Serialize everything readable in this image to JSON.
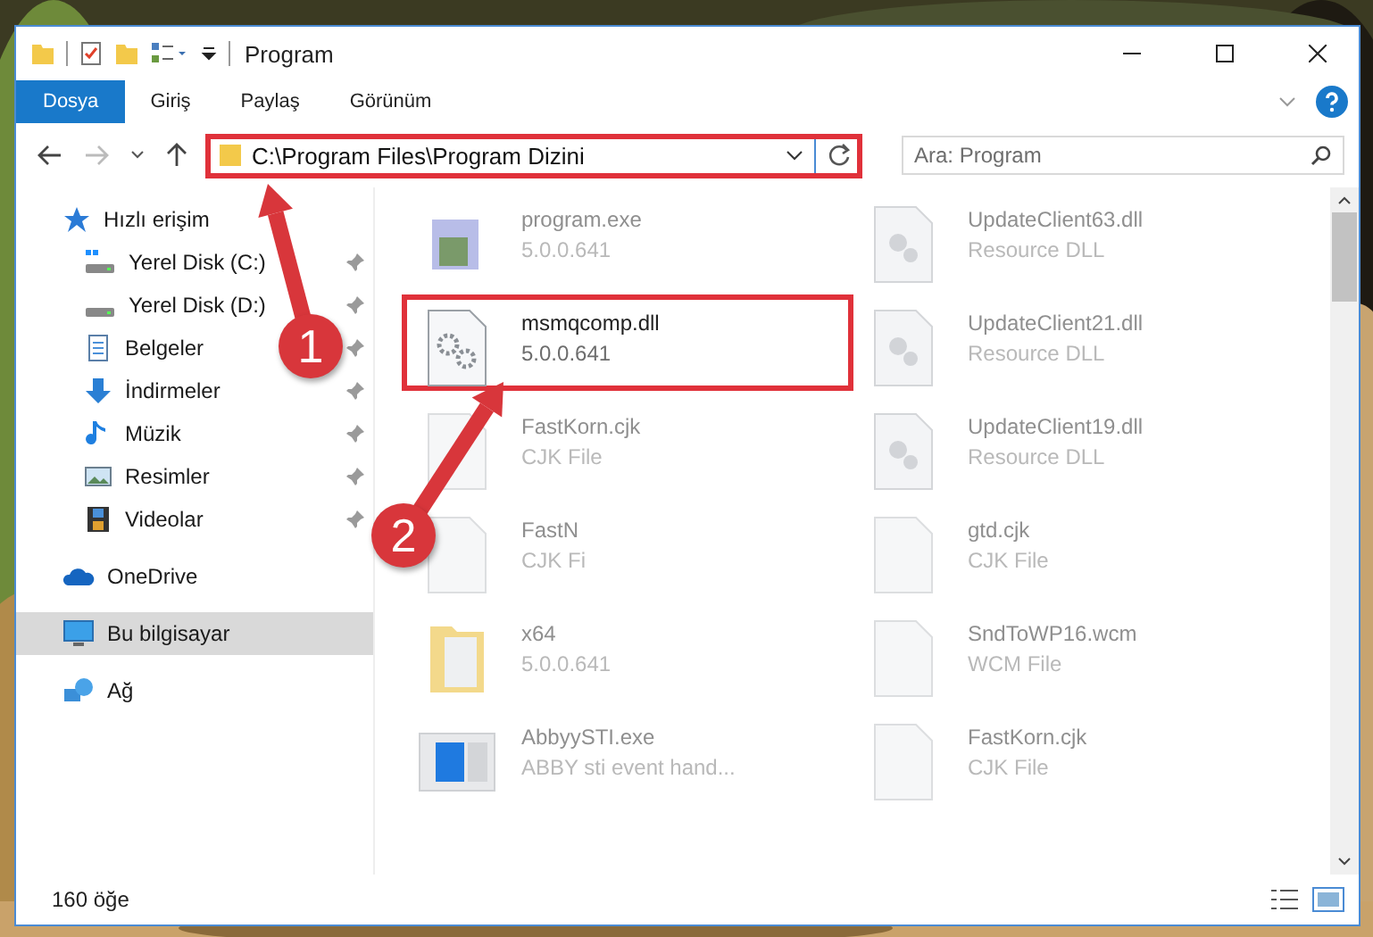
{
  "window": {
    "title": "Program"
  },
  "ribbon_tabs": [
    {
      "label": "Dosya",
      "kind": "file"
    },
    {
      "label": "Giriş",
      "kind": "tab"
    },
    {
      "label": "Paylaş",
      "kind": "tab"
    },
    {
      "label": "Görünüm",
      "kind": "tab"
    }
  ],
  "address_bar": {
    "path": "C:\\Program Files\\Program Dizini",
    "highlighted": true
  },
  "search": {
    "placeholder": "Ara: Program"
  },
  "navigation": [
    {
      "label": "Hızlı erişim",
      "selected": false,
      "children": [
        {
          "label": "Yerel Disk (C:)",
          "pinned": true,
          "selected": false
        },
        {
          "label": "Yerel Disk (D:)",
          "pinned": true,
          "selected": false
        },
        {
          "label": "Belgeler",
          "pinned": true,
          "selected": false
        },
        {
          "label": "İndirmeler",
          "pinned": true,
          "selected": false
        },
        {
          "label": "Müzik",
          "pinned": true,
          "selected": false
        },
        {
          "label": "Resimler",
          "pinned": true,
          "selected": false
        },
        {
          "label": "Videolar",
          "pinned": true,
          "selected": false
        }
      ]
    },
    {
      "label": "OneDrive",
      "selected": false
    },
    {
      "label": "Bu bilgisayar",
      "selected": true
    },
    {
      "label": "Ağ",
      "selected": false
    }
  ],
  "files": [
    {
      "name": "program.exe",
      "detail": "5.0.0.641",
      "highlighted": false
    },
    {
      "name": "UpdateClient63.dll",
      "detail": "Resource DLL",
      "highlighted": false
    },
    {
      "name": "msmqcomp.dll",
      "detail": "5.0.0.641",
      "highlighted": true
    },
    {
      "name": "UpdateClient21.dll",
      "detail": "Resource DLL",
      "highlighted": false
    },
    {
      "name": "FastKorn.cjk",
      "detail": "CJK File",
      "highlighted": false
    },
    {
      "name": "UpdateClient19.dll",
      "detail": "Resource DLL",
      "highlighted": false
    },
    {
      "name": "FastN",
      "detail": "CJK Fi",
      "highlighted": false
    },
    {
      "name": "gtd.cjk",
      "detail": "CJK File",
      "highlighted": false
    },
    {
      "name": "x64",
      "detail": "5.0.0.641",
      "highlighted": false
    },
    {
      "name": "SndToWP16.wcm",
      "detail": "WCM File",
      "highlighted": false
    },
    {
      "name": "AbbyySTI.exe",
      "detail": "ABBY sti event hand...",
      "highlighted": false
    },
    {
      "name": "FastKorn.cjk",
      "detail": "CJK File",
      "highlighted": false
    }
  ],
  "status_bar": {
    "item_count": "160 öğe"
  },
  "annotations": [
    {
      "label": "1"
    },
    {
      "label": "2"
    }
  ]
}
